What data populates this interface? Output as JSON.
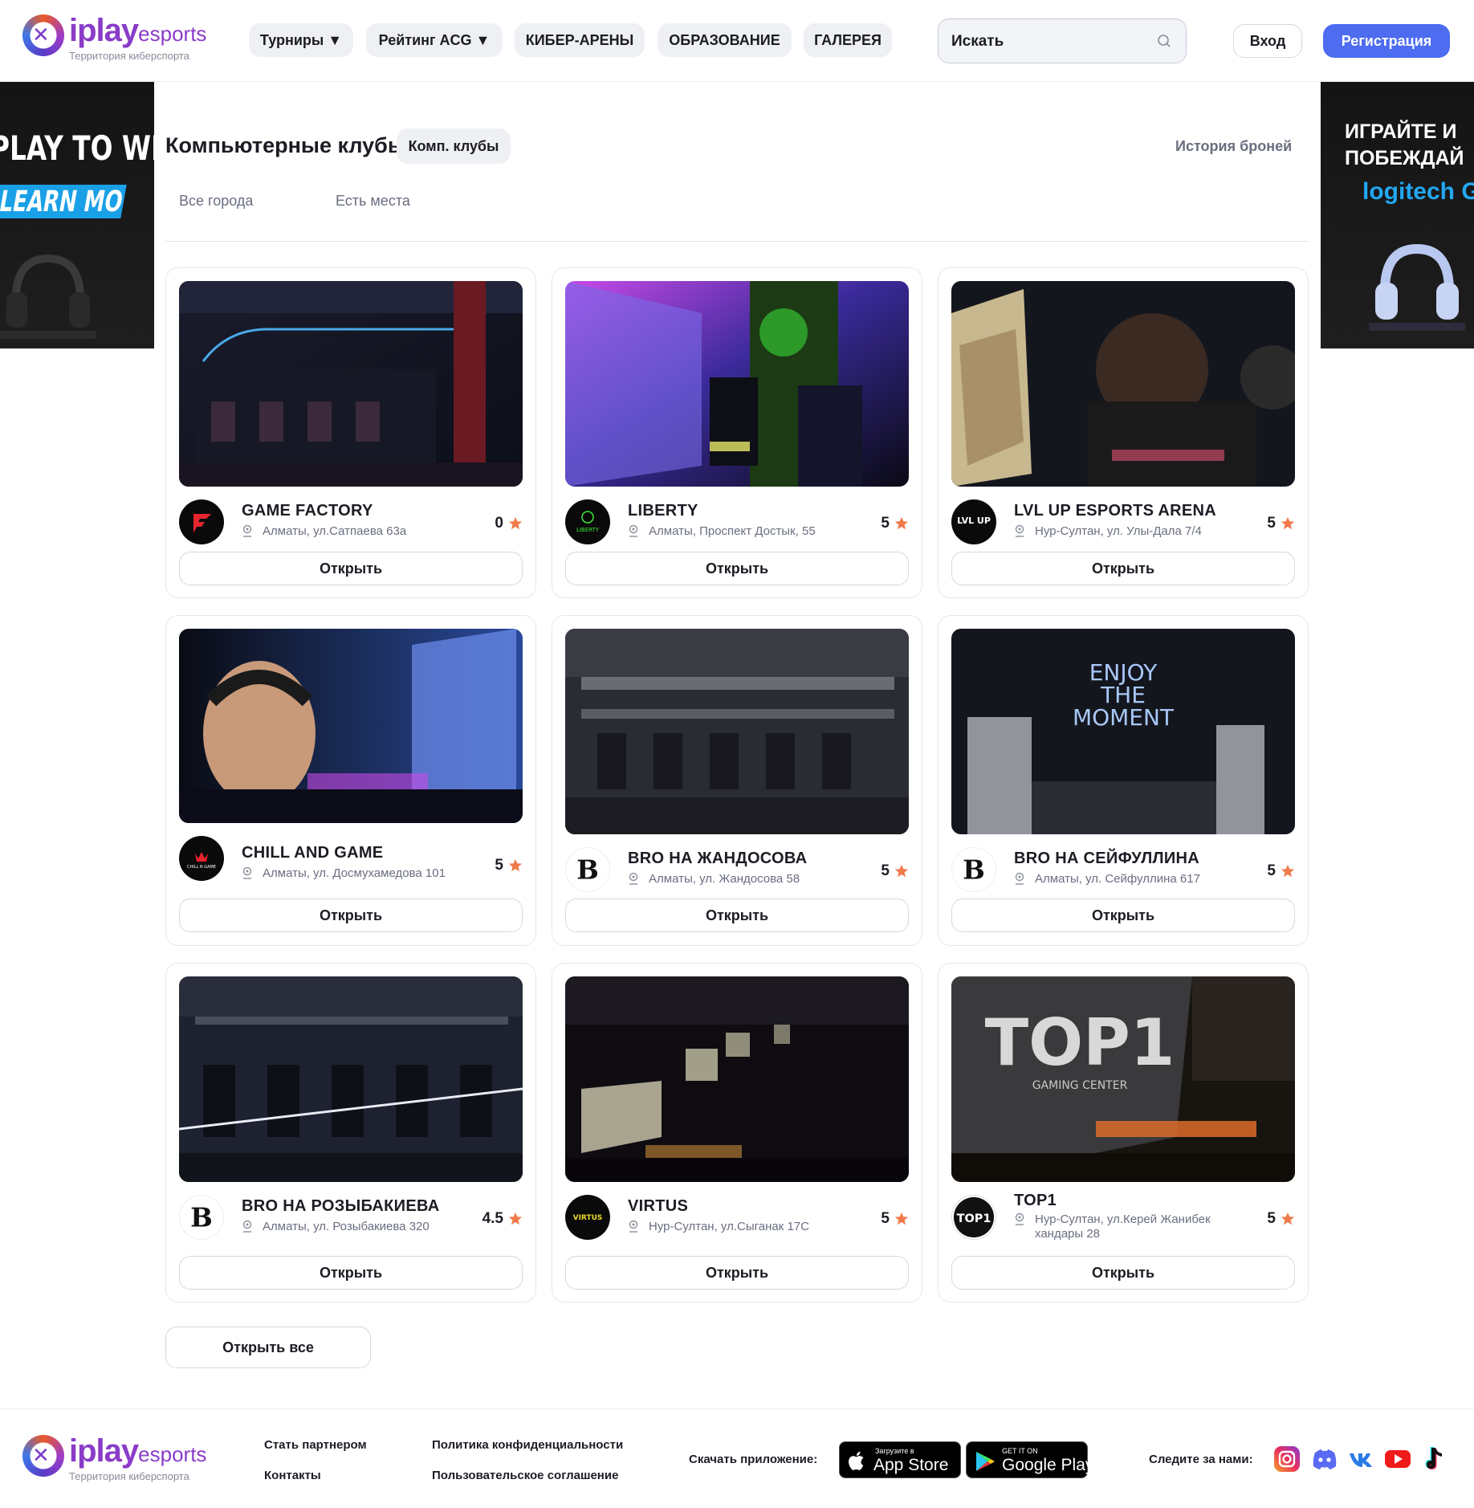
{
  "header": {
    "logo": {
      "brand": "iplay",
      "brand_suffix": "esports",
      "tagline": "Территория киберспорта"
    },
    "nav": [
      {
        "label": "Турниры ▼"
      },
      {
        "label": "Рейтинг ACG ▼"
      },
      {
        "label": "КИБЕР-АРЕНЫ"
      },
      {
        "label": "ОБРАЗОВАНИЕ"
      },
      {
        "label": "ГАЛЕРЕЯ"
      }
    ],
    "search": {
      "placeholder": "Искать"
    },
    "login_label": "Вход",
    "register_label": "Регистрация",
    "accent_color": "#4d6cf0"
  },
  "ads": {
    "left": {
      "line1": "PLAY TO WIN",
      "line2": "LEARN MORE"
    },
    "right": {
      "line1": "ИГРАЙТЕ И",
      "line2": "ПОБЕЖДАЙ",
      "brand": "logitech G"
    }
  },
  "main": {
    "title": "Компьютерные клубы",
    "chip": "Комп. клубы",
    "history_link": "История броней",
    "filters": {
      "city": "Все города",
      "availability": "Есть места"
    },
    "open_label": "Открыть",
    "open_all_label": "Открыть все",
    "star_color": "#f07a4a",
    "clubs": [
      {
        "name": "GAME FACTORY",
        "address": "Алматы, ул.Сатпаева 63а",
        "rating": "0"
      },
      {
        "name": "LIBERTY",
        "address": "Алматы, Проспект Достык, 55",
        "rating": "5"
      },
      {
        "name": "LVL UP ESPORTS ARENA",
        "address": "Нур-Султан, ул. Улы-Дала 7/4",
        "rating": "5"
      },
      {
        "name": "CHILL AND GAME",
        "address": "Алматы, ул. Досмухамедова 101",
        "rating": "5"
      },
      {
        "name": "BRO НА ЖАНДОСОВА",
        "address": "Алматы, ул. Жандосова 58",
        "rating": "5"
      },
      {
        "name": "BRO НА СЕЙФУЛЛИНА",
        "address": "Алматы, ул. Сейфуллина 617",
        "rating": "5"
      },
      {
        "name": "BRO НА РОЗЫБАКИЕВА",
        "address": "Алматы, ул. Розыбакиева 320",
        "rating": "4.5"
      },
      {
        "name": "VIRTUS",
        "address": "Нур-Султан, ул.Сыганак 17С",
        "rating": "5"
      },
      {
        "name": "TOP1",
        "address": "Нур-Султан, ул.Керей Жанибек хандары 28",
        "rating": "5"
      }
    ],
    "logo_texts": {
      "liberty": "LIBERTY",
      "lvlup": "LVL UP",
      "virtus": "VIRTUS",
      "bro": "B",
      "top1": "TOP1",
      "chill": "CHILL N GAME"
    },
    "photo_texts": {
      "enjoy": [
        "ENJOY",
        "THE",
        "MOMENT"
      ],
      "top1": "TOP1",
      "gaming_center": "GAMING CENTER"
    }
  },
  "footer": {
    "logo": {
      "brand": "iplay",
      "brand_suffix": "esports",
      "tagline": "Территория киберспорта"
    },
    "links": {
      "partner": "Стать партнером",
      "contacts": "Контакты",
      "privacy": "Политика конфиденциальности",
      "terms": "Пользовательское соглашение"
    },
    "download_label": "Скачать приложение:",
    "appstore": {
      "small": "Загрузите в",
      "big": "App Store"
    },
    "googleplay": {
      "small": "GET IT ON",
      "big": "Google Play"
    },
    "follow_label": "Следите за нами:",
    "socials": [
      "instagram-icon",
      "discord-icon",
      "vk-icon",
      "youtube-icon",
      "tiktok-icon"
    ]
  }
}
